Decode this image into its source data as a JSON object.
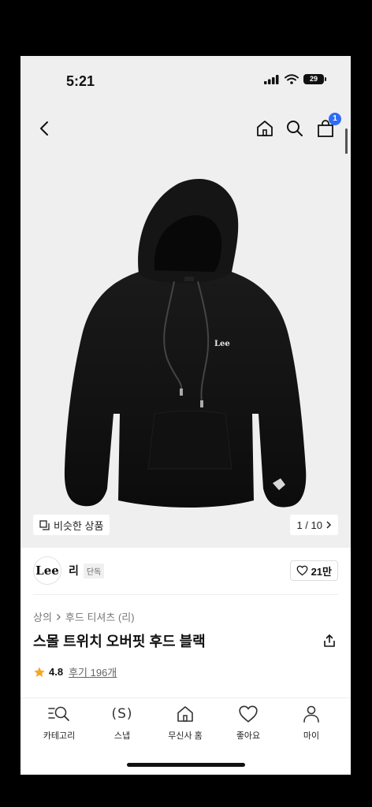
{
  "status_bar": {
    "time": "5:21",
    "battery": "29"
  },
  "nav": {
    "cart_count": "1"
  },
  "gallery": {
    "similar_label": "비슷한 상품",
    "page_indicator": "1 / 10",
    "logo_text": "Lee"
  },
  "brand": {
    "logo_text": "Lee",
    "name": "리",
    "tag": "단독",
    "likes": "21만"
  },
  "product": {
    "breadcrumb": [
      "상의",
      "후드 티셔츠 (리)"
    ],
    "title": "스몰 트위치 오버핏 후드 블랙",
    "rating": "4.8",
    "reviews": "후기 196개"
  },
  "tabs": [
    {
      "label": "카테고리",
      "icon": "category-search-icon"
    },
    {
      "label": "스냅",
      "icon": "snap-icon",
      "icon_text": "(S)"
    },
    {
      "label": "무신사 홈",
      "icon": "home-icon"
    },
    {
      "label": "좋아요",
      "icon": "heart-icon"
    },
    {
      "label": "마이",
      "icon": "person-icon"
    }
  ],
  "colors": {
    "accent": "#2f6cf6",
    "star": "#f5a623",
    "image_bg": "#efefef"
  }
}
